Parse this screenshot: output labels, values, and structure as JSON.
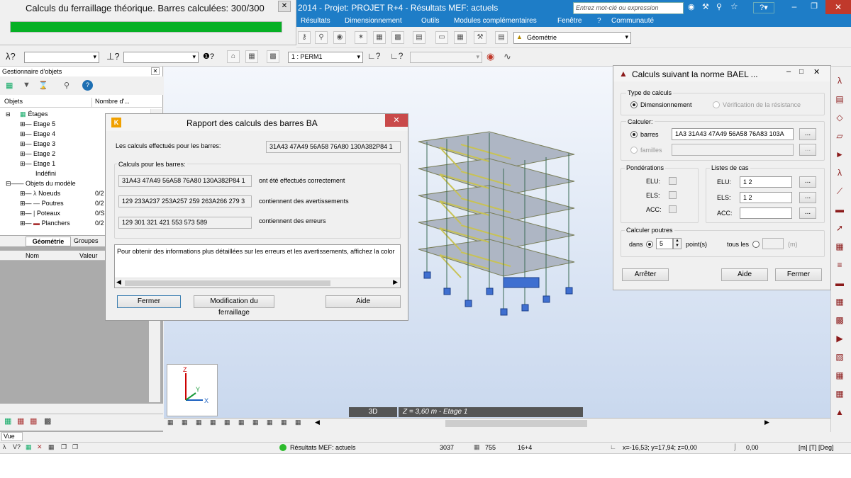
{
  "progress": {
    "title": "Calculs du ferraillage théorique.  Barres calculées:  300/300",
    "fraction": 1.0
  },
  "title_bar": {
    "title": "2014 - Projet: PROJET R+4 - Résultats MEF: actuels",
    "search_placeholder": "Entrez mot-clé ou expression"
  },
  "menu": [
    "Résultats",
    "Dimensionnement",
    "Outils",
    "Modules complémentaires",
    "Fenêtre",
    "?",
    "Communauté"
  ],
  "toolbar": {
    "view_select": "Géométrie",
    "case_select": "1 : PERM1"
  },
  "object_manager": {
    "title": "Gestionnaire d'objets",
    "col_objects": "Objets",
    "col_count": "Nombre d'...",
    "tree": [
      {
        "label": "Étages",
        "count": ""
      },
      {
        "label": "Etage 5",
        "count": ""
      },
      {
        "label": "Etage 4",
        "count": ""
      },
      {
        "label": "Etage 3",
        "count": ""
      },
      {
        "label": "Etage 2",
        "count": ""
      },
      {
        "label": "Etage 1",
        "count": ""
      },
      {
        "label": "Indéfini",
        "count": ""
      },
      {
        "label": "Objets du modèle",
        "count": ""
      },
      {
        "label": "Noeuds",
        "count": "0/2"
      },
      {
        "label": "Poutres",
        "count": "0/2"
      },
      {
        "label": "Poteaux",
        "count": "0/S"
      },
      {
        "label": "Planchers",
        "count": "0/2"
      }
    ],
    "tabs": [
      "Géométrie",
      "Groupes"
    ],
    "prop_col_name": "Nom",
    "prop_col_value": "Valeur"
  },
  "report": {
    "title": "Rapport des calculs des barres BA",
    "performed_label": "Les calculs effectués pour les barres:",
    "performed_value": "31A43 47A49 56A58 76A80 130A382P84 1",
    "group_title": "Calculs pour les barres:",
    "rows": [
      {
        "value": "31A43 47A49 56A58 76A80 130A382P84 1",
        "desc": "ont été effectués correctement"
      },
      {
        "value": "129 233A237 253A257 259 263A266 279 3",
        "desc": "contiennent des avertissements"
      },
      {
        "value": "129 301 321 421 553 573 589",
        "desc": "contiennent des erreurs"
      }
    ],
    "info": "Pour obtenir des informations plus détaillées sur les erreurs et les avertissements, affichez la color",
    "btn_close": "Fermer",
    "btn_modify": "Modification du ferraillage",
    "btn_help": "Aide"
  },
  "bael": {
    "title": "Calculs suivant la norme BAEL ...",
    "calc_type_title": "Type de calculs",
    "opt_dim": "Dimensionnement",
    "opt_verif": "Vérification de la résistance",
    "calc_title": "Calculer:",
    "opt_bars": "barres",
    "bars_value": "1A3 31A43 47A49 56A58 76A83 103A",
    "opt_families": "familles",
    "weights_title": "Pondérations",
    "cases_title": "Listes de cas",
    "elu": "ELU:",
    "els": "ELS:",
    "acc": "ACC:",
    "elu_value": "1 2",
    "els_value": "1 2",
    "acc_value": "",
    "beams_title": "Calculer poutres",
    "in_label": "dans",
    "points_value": "5",
    "points_label": "point(s)",
    "all_label": "tous les",
    "unit": "(m)",
    "btn_stop": "Arrêter",
    "btn_help": "Aide",
    "btn_close": "Fermer"
  },
  "viewport": {
    "mode": "3D",
    "level": "Z = 3,60 m - Etage 1",
    "view_label": "Vue"
  },
  "status": {
    "results": "Résultats MEF: actuels",
    "count1": "3037",
    "count2": "755",
    "count3": "16+4",
    "coords": "x=-16,53; y=17,94; z=0,00",
    "angle": "0,00",
    "units": "[m] [T] [Deg]"
  }
}
